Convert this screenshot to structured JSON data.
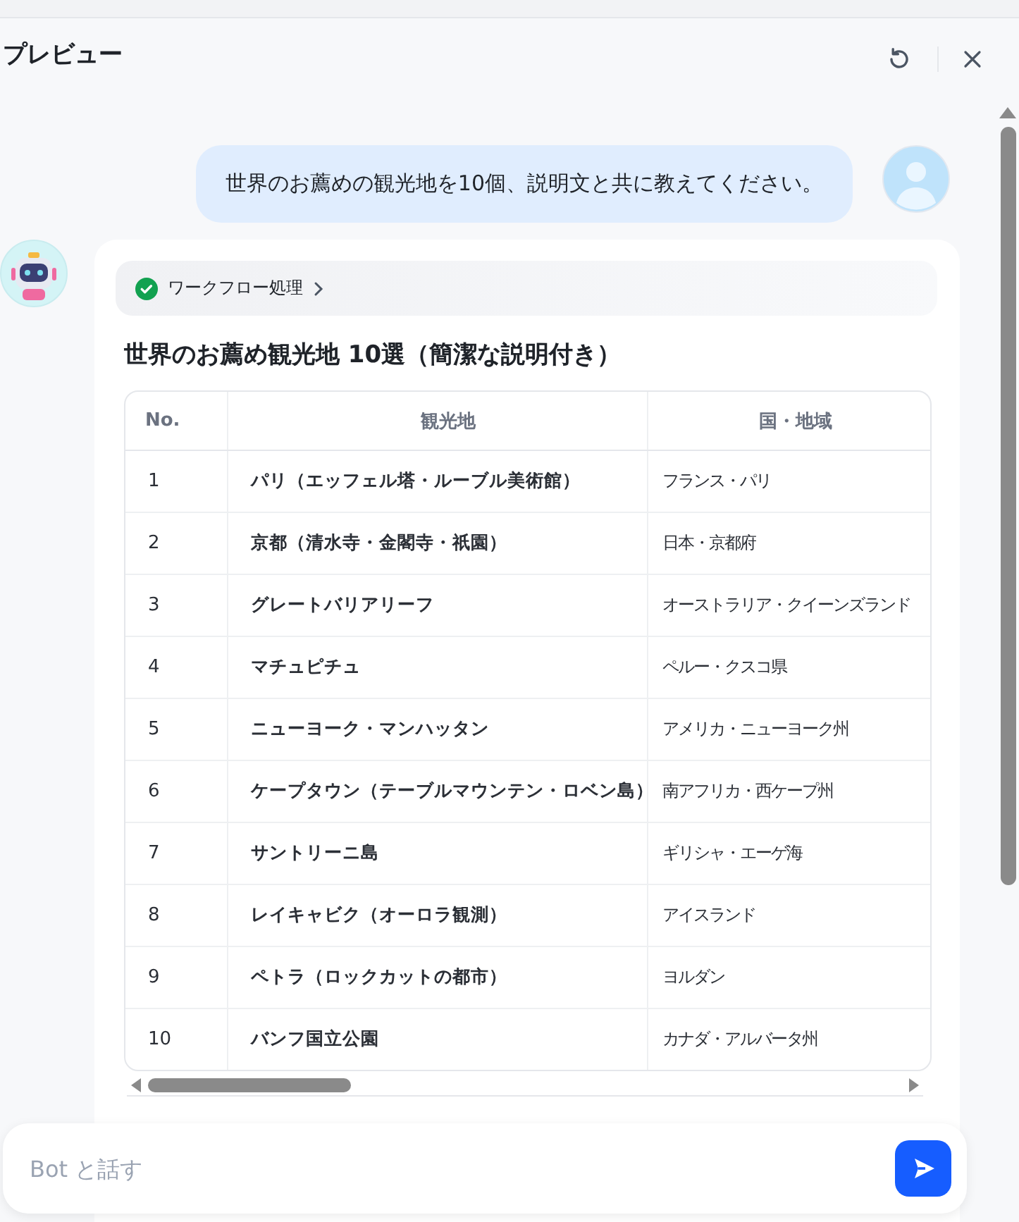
{
  "header": {
    "title": "プレビュー"
  },
  "user_message": {
    "text": "世界のお薦めの観光地を10個、説明文と共に教えてください。"
  },
  "bot_message": {
    "workflow": {
      "label": "ワークフロー処理",
      "done": true
    },
    "title": "世界のお薦め観光地 10選（簡潔な説明付き）",
    "table": {
      "columns": [
        "No.",
        "観光地",
        "国・地域"
      ],
      "rows": [
        [
          "1",
          "パリ（エッフェル塔・ルーブル美術館）",
          "フランス・パリ"
        ],
        [
          "2",
          "京都（清水寺・金閣寺・祇園）",
          "日本・京都府"
        ],
        [
          "3",
          "グレートバリアリーフ",
          "オーストラリア・クイーンズランド"
        ],
        [
          "4",
          "マチュピチュ",
          "ペルー・クスコ県"
        ],
        [
          "5",
          "ニューヨーク・マンハッタン",
          "アメリカ・ニューヨーク州"
        ],
        [
          "6",
          "ケープタウン（テーブルマウンテン・ロベン島）",
          "南アフリカ・西ケープ州"
        ],
        [
          "7",
          "サントリーニ島",
          "ギリシャ・エーゲ海"
        ],
        [
          "8",
          "レイキャビク（オーロラ観測）",
          "アイスランド"
        ],
        [
          "9",
          "ペトラ（ロックカットの都市）",
          "ヨルダン"
        ],
        [
          "10",
          "バンフ国立公園",
          "カナダ・アルバータ州"
        ]
      ]
    }
  },
  "input": {
    "placeholder": "Bot と話す"
  }
}
